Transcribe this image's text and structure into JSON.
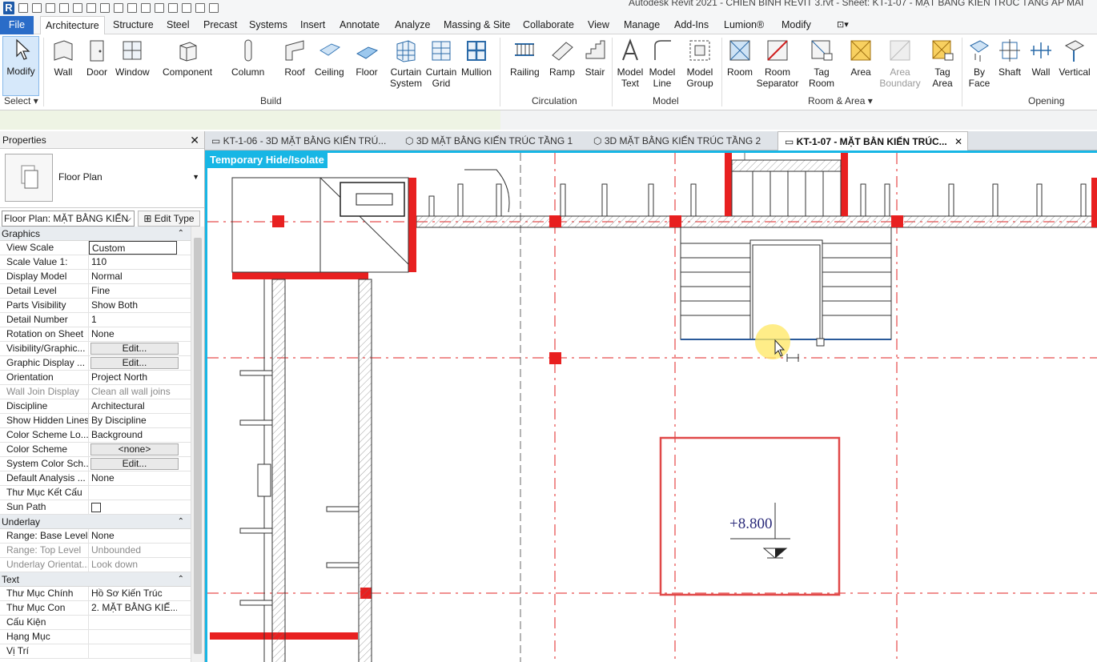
{
  "app": {
    "window_title": "Autodesk Revit 2021 - CHIẾN BÌNH REVIT 3.rvt - Sheet: KT-1-07 - MẶT BẰNG KIẾN TRÚC TẦNG ÁP MÁI",
    "logo": "R"
  },
  "menu": {
    "tabs": [
      "File",
      "Architecture",
      "Structure",
      "Steel",
      "Precast",
      "Systems",
      "Insert",
      "Annotate",
      "Analyze",
      "Massing & Site",
      "Collaborate",
      "View",
      "Manage",
      "Add-Ins",
      "Lumion®",
      "Modify"
    ],
    "active": "Architecture"
  },
  "ribbon": {
    "select": {
      "modify": "Modify",
      "label": "Select"
    },
    "build": {
      "label": "Build",
      "buttons": [
        "Wall",
        "Door",
        "Window",
        "Component",
        "Column",
        "Roof",
        "Ceiling",
        "Floor",
        "Curtain System",
        "Curtain Grid",
        "Mullion"
      ]
    },
    "circulation": {
      "label": "Circulation",
      "buttons": [
        "Railing",
        "Ramp",
        "Stair"
      ]
    },
    "model": {
      "label": "Model",
      "buttons": [
        "Model Text",
        "Model Line",
        "Model Group"
      ]
    },
    "room_area": {
      "label": "Room & Area",
      "buttons": [
        "Room",
        "Room Separator",
        "Tag Room",
        "Area",
        "Area Boundary",
        "Tag Area"
      ]
    },
    "opening": {
      "label": "Opening",
      "buttons": [
        "By Face",
        "Shaft",
        "Wall",
        "Vertical"
      ]
    }
  },
  "properties": {
    "title": "Properties",
    "type_name": "Floor Plan",
    "selector": "Floor Plan: MẶT BẰNG KIẾN",
    "edit_type": "Edit Type",
    "sections": [
      {
        "name": "Graphics",
        "rows": [
          {
            "k": "View Scale",
            "v": "Custom",
            "style": "boxed"
          },
          {
            "k": "Scale Value    1:",
            "v": "110"
          },
          {
            "k": "Display Model",
            "v": "Normal"
          },
          {
            "k": "Detail Level",
            "v": "Fine"
          },
          {
            "k": "Parts Visibility",
            "v": "Show Both"
          },
          {
            "k": "Detail Number",
            "v": "1"
          },
          {
            "k": "Rotation on Sheet",
            "v": "None"
          },
          {
            "k": "Visibility/Graphic...",
            "v": "Edit...",
            "style": "btn"
          },
          {
            "k": "Graphic Display ...",
            "v": "Edit...",
            "style": "btn"
          },
          {
            "k": "Orientation",
            "v": "Project North"
          },
          {
            "k": "Wall Join Display",
            "v": "Clean all wall joins",
            "style": "dis"
          },
          {
            "k": "Discipline",
            "v": "Architectural"
          },
          {
            "k": "Show Hidden Lines",
            "v": "By Discipline"
          },
          {
            "k": "Color Scheme Lo...",
            "v": "Background"
          },
          {
            "k": "Color Scheme",
            "v": "<none>",
            "style": "btn"
          },
          {
            "k": "System Color Sch...",
            "v": "Edit...",
            "style": "btn"
          },
          {
            "k": "Default Analysis ...",
            "v": "None"
          },
          {
            "k": "Thư Mục Kết Cấu",
            "v": ""
          },
          {
            "k": "Sun Path",
            "v": "",
            "style": "check"
          }
        ]
      },
      {
        "name": "Underlay",
        "rows": [
          {
            "k": "Range: Base Level",
            "v": "None"
          },
          {
            "k": "Range: Top Level",
            "v": "Unbounded",
            "style": "dis"
          },
          {
            "k": "Underlay Orientat...",
            "v": "Look down",
            "style": "dis"
          }
        ]
      },
      {
        "name": "Text",
        "rows": [
          {
            "k": "Thư Mục Chính",
            "v": "Hồ Sơ Kiến Trúc"
          },
          {
            "k": "Thư Mục Con",
            "v": "2. MẶT BẰNG KIẾ..."
          },
          {
            "k": "Cấu Kiện",
            "v": ""
          },
          {
            "k": "Hạng Mục",
            "v": ""
          },
          {
            "k": "Vị Trí",
            "v": ""
          }
        ]
      }
    ]
  },
  "view_tabs": [
    {
      "label": "KT-1-06 - 3D MẶT BẰNG KIẾN TRÚ...",
      "icon": "sheet-icon"
    },
    {
      "label": "3D MẶT BẰNG KIẾN TRÚC TẦNG 1",
      "icon": "3d-view-icon"
    },
    {
      "label": "3D MẶT BẰNG KIẾN TRÚC TẦNG 2",
      "icon": "3d-view-icon"
    },
    {
      "label": "KT-1-07 - MẶT BẰN KIẾN TRÚC...",
      "icon": "sheet-icon",
      "active": true
    }
  ],
  "canvas": {
    "banner": "Temporary Hide/Isolate",
    "level_value": "+8.800"
  },
  "colors": {
    "accent": "#17b6e5",
    "file_tab": "#2a6cc8",
    "grid_red": "#e02020",
    "highlight_box": "#e04848"
  }
}
